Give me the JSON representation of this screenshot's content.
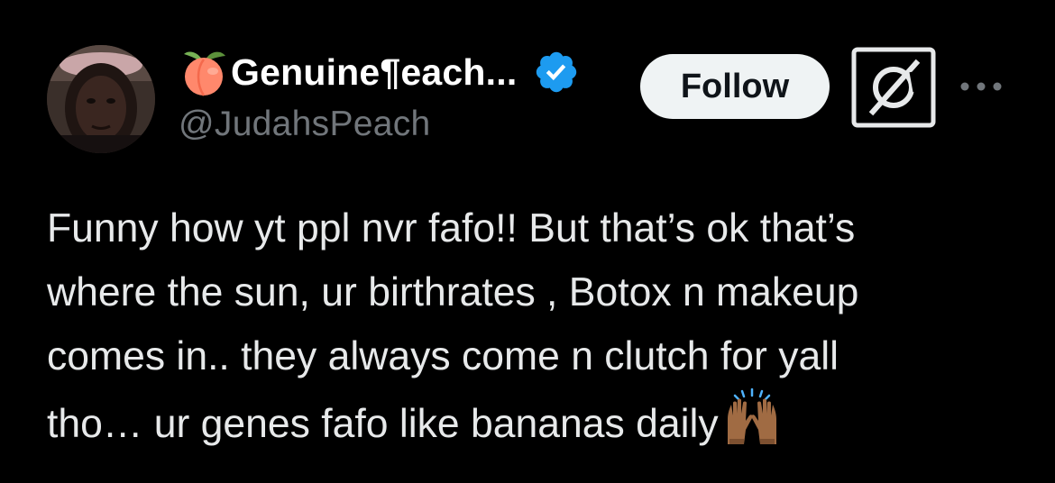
{
  "author": {
    "display_name": "Genuine¶each...",
    "handle": "@JudahsPeach",
    "name_emoji": "peach-icon",
    "verified_icon": "verified-badge-icon",
    "verified_color": "#1d9bf0"
  },
  "actions": {
    "follow_label": "Follow",
    "grok_icon": "grok-icon",
    "more_icon": "more-icon"
  },
  "tweet": {
    "lines": [
      "Funny how yt ppl nvr fafo!! But that’s ok that’s",
      "where the sun, ur birthrates , Botox n makeup",
      "comes in.. they always come n clutch for yall",
      "tho… ur genes fafo like bananas daily"
    ],
    "trailing_emoji": "raising-hands-icon"
  },
  "colors": {
    "background": "#000000",
    "text_primary": "#e7e9ea",
    "text_secondary": "#71767b",
    "follow_bg": "#eff3f4",
    "follow_text": "#0f1419"
  }
}
